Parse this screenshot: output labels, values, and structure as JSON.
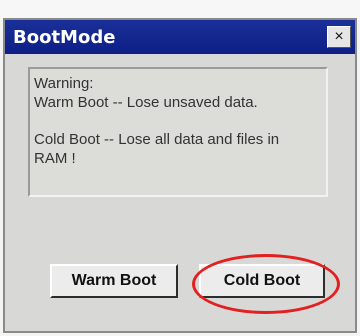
{
  "dialog": {
    "title": "BootMode",
    "close_glyph": "×",
    "message": {
      "line1": "Warning:",
      "line2": "Warm Boot -- Lose unsaved data.",
      "line3": "Cold Boot -- Lose all data and files in",
      "line4": "RAM !"
    },
    "buttons": {
      "warm_boot": "Warm Boot",
      "cold_boot": "Cold Boot"
    },
    "highlight_color": "#e32020",
    "titlebar_color": "#0d1f86"
  }
}
